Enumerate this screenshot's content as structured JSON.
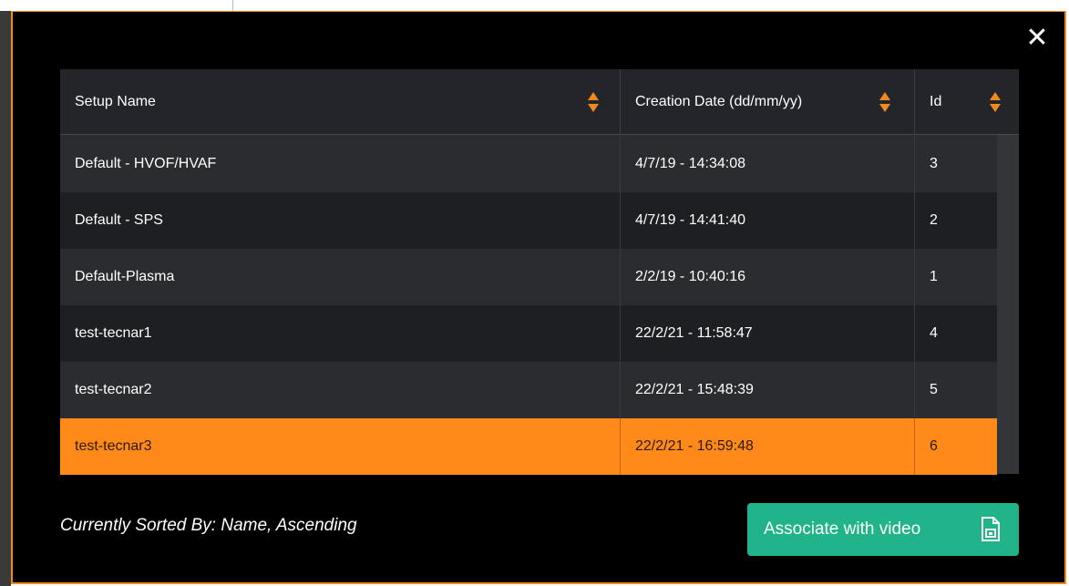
{
  "dialog": {
    "close_label": "✕"
  },
  "table": {
    "columns": [
      {
        "label": "Setup Name"
      },
      {
        "label": "Creation Date (dd/mm/yy)"
      },
      {
        "label": "Id"
      }
    ],
    "rows": [
      {
        "name": "Default - HVOF/HVAF",
        "date": "4/7/19 - 14:34:08",
        "id": "3"
      },
      {
        "name": "Default - SPS",
        "date": "4/7/19 - 14:41:40",
        "id": "2"
      },
      {
        "name": "Default-Plasma",
        "date": "2/2/19 - 10:40:16",
        "id": "1"
      },
      {
        "name": "test-tecnar1",
        "date": "22/2/21 - 11:58:47",
        "id": "4"
      },
      {
        "name": "test-tecnar2",
        "date": "22/2/21 - 15:48:39",
        "id": "5"
      },
      {
        "name": "test-tecnar3",
        "date": "22/2/21 - 16:59:48",
        "id": "6"
      }
    ],
    "selected_row_index": 5
  },
  "footer": {
    "sort_status": "Currently Sorted By: Name, Ascending",
    "associate_button": "Associate with video"
  },
  "colors": {
    "accent_orange": "#f08a1e",
    "selected_row": "#ff8a1a",
    "button_green": "#21b48a",
    "modal_bg": "#000000"
  }
}
